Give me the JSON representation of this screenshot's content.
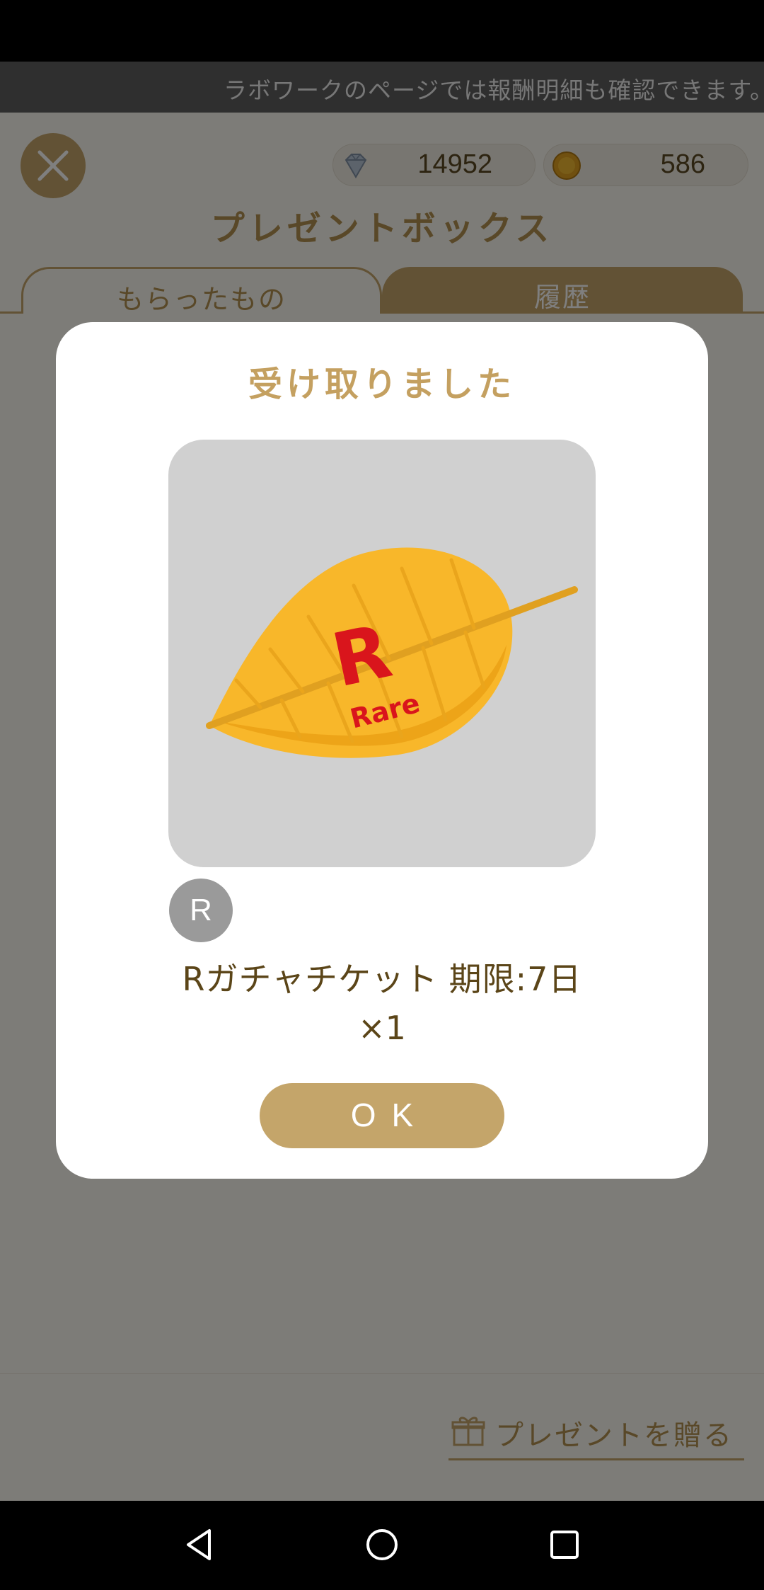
{
  "ticker": {
    "text": "ラボワークのページでは報酬明細も確認できます。"
  },
  "header": {
    "gems": "14952",
    "coins": "586",
    "title": "プレゼントボックス"
  },
  "tabs": {
    "received": "もらったもの",
    "history": "履歴"
  },
  "footer": {
    "send_gift": "プレゼントを贈る"
  },
  "modal": {
    "title": "受け取りました",
    "item_image_text": {
      "big": "R",
      "small": "Rare"
    },
    "rarity": "R",
    "item_name": "Rガチャチケット 期限:7日",
    "quantity": "×1",
    "ok_label": "OK"
  },
  "colors": {
    "accent": "#c5a56a",
    "accent_text": "#b39150",
    "leaf": "#f8b72a"
  },
  "icons": [
    "close-icon",
    "diamond-icon",
    "coin-icon",
    "gift-icon",
    "back-icon",
    "home-icon",
    "recents-icon"
  ]
}
